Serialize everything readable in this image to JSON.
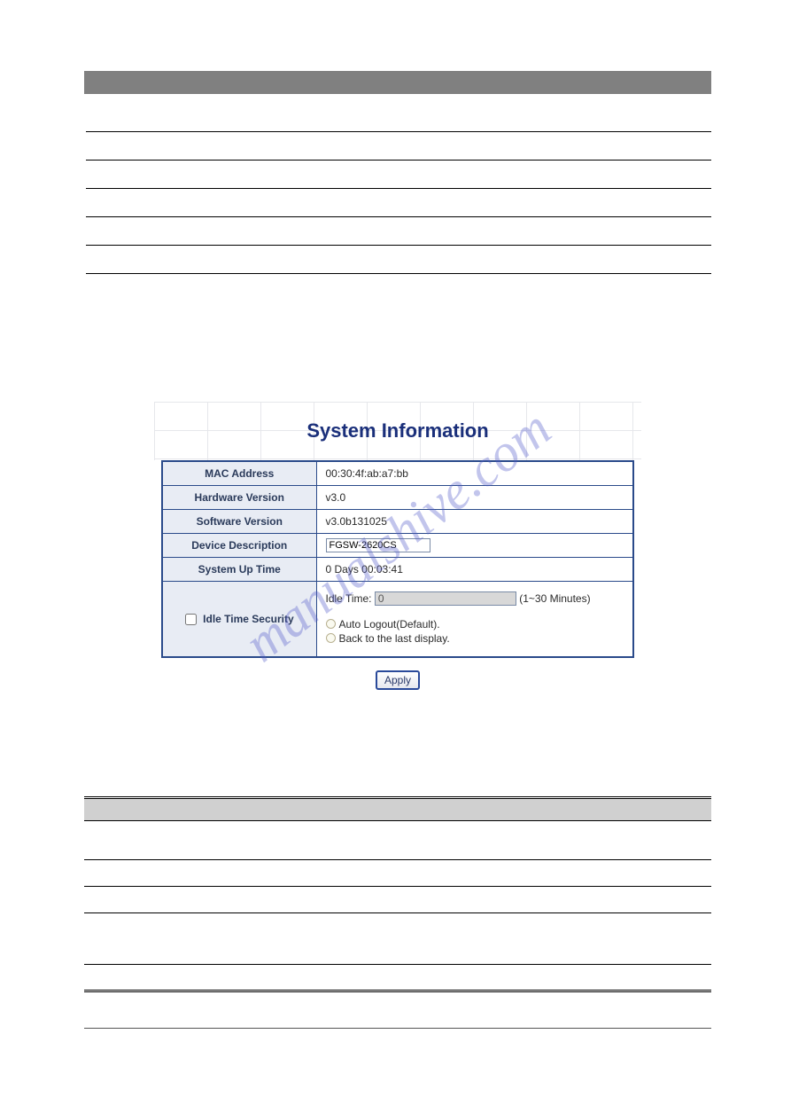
{
  "watermark": "manualshive.com",
  "sysinfo": {
    "title": "System Information",
    "rows": {
      "mac_label": "MAC Address",
      "mac_value": "00:30:4f:ab:a7:bb",
      "hw_label": "Hardware Version",
      "hw_value": "v3.0",
      "sw_label": "Software Version",
      "sw_value": "v3.0b131025",
      "desc_label": "Device Description",
      "desc_value": "FGSW-2620CS",
      "uptime_label": "System Up Time",
      "uptime_value": "0 Days 00:03:41",
      "idle_checkbox_label": "Idle Time Security",
      "idle_time_label": "Idle Time:",
      "idle_time_value": "0",
      "idle_time_hint": "(1~30 Minutes)",
      "radio_auto": "Auto Logout(Default).",
      "radio_back": "Back to the last display."
    },
    "apply_label": "Apply"
  }
}
